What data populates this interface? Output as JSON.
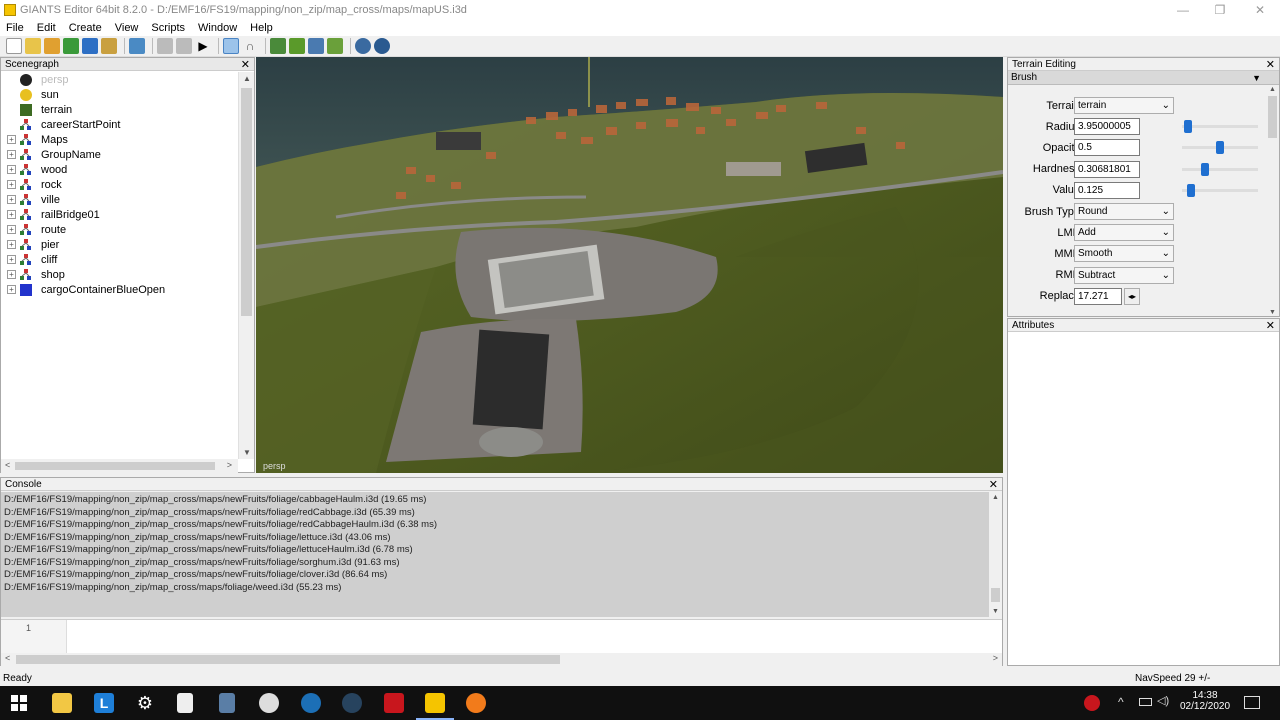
{
  "window": {
    "title": "GIANTS Editor 64bit 8.2.0 - D:/EMF16/FS19/mapping/non_zip/map_cross/maps/mapUS.i3d",
    "controls": [
      "—",
      "❐",
      "✕"
    ]
  },
  "menu": [
    "File",
    "Edit",
    "Create",
    "View",
    "Scripts",
    "Window",
    "Help"
  ],
  "scenegraph": {
    "title": "Scenegraph",
    "items": [
      {
        "label": "persp",
        "icon": "camera-icon",
        "expandable": false,
        "dim": true
      },
      {
        "label": "sun",
        "icon": "light-bulb-icon",
        "expandable": false
      },
      {
        "label": "terrain",
        "icon": "terrain-icon",
        "expandable": false
      },
      {
        "label": "careerStartPoint",
        "icon": "transform-group-icon",
        "expandable": false
      },
      {
        "label": "Maps",
        "icon": "transform-group-icon",
        "expandable": true
      },
      {
        "label": "GroupName",
        "icon": "transform-group-icon",
        "expandable": true
      },
      {
        "label": "wood",
        "icon": "transform-group-icon",
        "expandable": true
      },
      {
        "label": "rock",
        "icon": "transform-group-icon",
        "expandable": true
      },
      {
        "label": "ville",
        "icon": "transform-group-icon",
        "expandable": true
      },
      {
        "label": "railBridge01",
        "icon": "transform-group-icon",
        "expandable": true
      },
      {
        "label": "route",
        "icon": "transform-group-icon",
        "expandable": true
      },
      {
        "label": "pier",
        "icon": "transform-group-icon",
        "expandable": true
      },
      {
        "label": "cliff",
        "icon": "transform-group-icon",
        "expandable": true
      },
      {
        "label": "shop",
        "icon": "transform-group-icon",
        "expandable": true
      },
      {
        "label": "cargoContainerBlueOpen",
        "icon": "shape-cube-icon",
        "expandable": true
      }
    ]
  },
  "viewport": {
    "camera_label": "persp"
  },
  "terrain_editing": {
    "title": "Terrain Editing",
    "section": "Brush",
    "fields": [
      {
        "label": "Terrain",
        "kind": "select",
        "value": "terrain"
      },
      {
        "label": "Radius",
        "kind": "input",
        "value": "3.95000005",
        "slider": 0.08
      },
      {
        "label": "Opacity",
        "kind": "input",
        "value": "0.5",
        "slider": 0.5
      },
      {
        "label": "Hardness",
        "kind": "input",
        "value": "0.30681801",
        "slider": 0.3
      },
      {
        "label": "Value",
        "kind": "input",
        "value": "0.125",
        "slider": 0.12
      },
      {
        "label": "Brush Type",
        "kind": "select",
        "value": "Round"
      },
      {
        "label": "LMB",
        "kind": "select",
        "value": "Add"
      },
      {
        "label": "MMB",
        "kind": "select",
        "value": "Smooth"
      },
      {
        "label": "RMB",
        "kind": "select",
        "value": "Subtract"
      },
      {
        "label": "Replace",
        "kind": "spin",
        "value": "17.271"
      }
    ]
  },
  "attributes": {
    "title": "Attributes"
  },
  "console": {
    "title": "Console",
    "lines": [
      "D:/EMF16/FS19/mapping/non_zip/map_cross/maps/newFruits/foliage/cabbageHaulm.i3d (19.65 ms)",
      "D:/EMF16/FS19/mapping/non_zip/map_cross/maps/newFruits/foliage/redCabbage.i3d (65.39 ms)",
      "D:/EMF16/FS19/mapping/non_zip/map_cross/maps/newFruits/foliage/redCabbageHaulm.i3d (6.38 ms)",
      "D:/EMF16/FS19/mapping/non_zip/map_cross/maps/newFruits/foliage/lettuce.i3d (43.06 ms)",
      "D:/EMF16/FS19/mapping/non_zip/map_cross/maps/newFruits/foliage/lettuceHaulm.i3d (6.78 ms)",
      "D:/EMF16/FS19/mapping/non_zip/map_cross/maps/newFruits/foliage/sorghum.i3d (91.63 ms)",
      "D:/EMF16/FS19/mapping/non_zip/map_cross/maps/newFruits/foliage/clover.i3d (86.64 ms)",
      "D:/EMF16/FS19/mapping/non_zip/map_cross/maps/foliage/weed.i3d (55.23 ms)"
    ],
    "input_line_number": "1"
  },
  "status": {
    "left": "Ready",
    "right": "NavSpeed 29 +/-"
  },
  "taskbar": {
    "time": "14:38",
    "date": "02/12/2020",
    "apps": [
      "windows-start-icon",
      "file-explorer-icon",
      "launcher-l-icon",
      "settings-gear-icon",
      "notepad-icon",
      "calculator-icon",
      "obs-icon",
      "musescore-icon",
      "steam-icon",
      "giants-g-icon",
      "giants-editor-icon",
      "firefox-icon"
    ],
    "tray": [
      "antivirus-icon",
      "chevron-up-icon",
      "battery-icon",
      "volume-icon"
    ]
  }
}
